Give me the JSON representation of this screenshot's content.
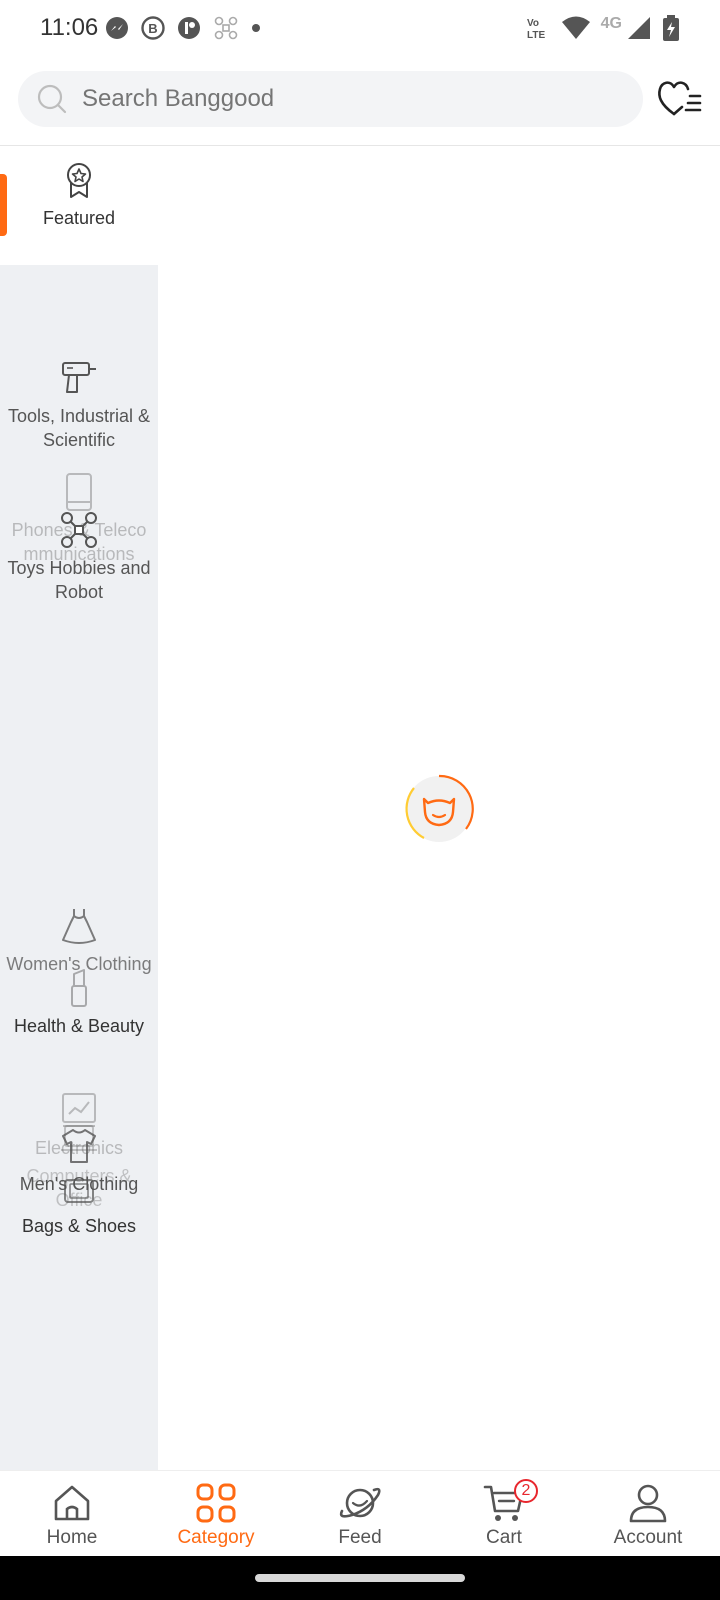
{
  "status_bar": {
    "time": "11:06",
    "network_label": "4G",
    "volte_label": "Vo LTE"
  },
  "search": {
    "placeholder": "Search Banggood"
  },
  "sidebar": {
    "items": [
      {
        "label": "Featured",
        "icon": "award-ribbon-icon",
        "active": true
      },
      {
        "label": "Tools, Industrial & Scientific",
        "icon": "drill-icon"
      },
      {
        "label": "Phones & Telecommunications",
        "icon": "phone-icon"
      },
      {
        "label": "Toys Hobbies and Robot",
        "icon": "drone-icon"
      },
      {
        "label": "Women's Clothing",
        "icon": "dress-icon"
      },
      {
        "label": "Health & Beauty",
        "icon": "lipstick-icon"
      },
      {
        "label": "Electronics",
        "icon": "circuit-board-icon"
      },
      {
        "label": "Computers & Office",
        "icon": "laptop-icon"
      },
      {
        "label": "Men's Clothing",
        "icon": "shirt-icon"
      },
      {
        "label": "Bags & Shoes",
        "icon": "bag-icon"
      }
    ]
  },
  "bottom_nav": {
    "items": [
      {
        "label": "Home",
        "icon": "home-icon"
      },
      {
        "label": "Category",
        "icon": "category-grid-icon",
        "active": true
      },
      {
        "label": "Feed",
        "icon": "planet-icon"
      },
      {
        "label": "Cart",
        "icon": "cart-icon",
        "badge": "2"
      },
      {
        "label": "Account",
        "icon": "account-icon"
      }
    ]
  },
  "colors": {
    "accent": "#ff6a13",
    "badge": "#e8262d",
    "sidebar_bg": "#eef0f3"
  }
}
